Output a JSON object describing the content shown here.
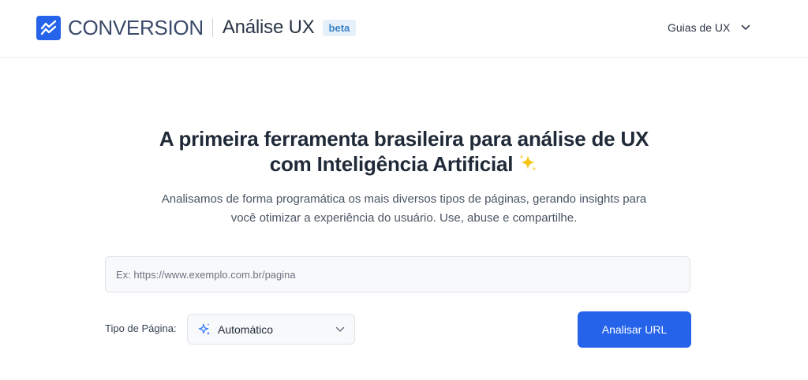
{
  "header": {
    "brand_name": "CONVERSION",
    "product_name": "Análise UX",
    "badge": "beta",
    "nav_guides": "Guias de UX"
  },
  "hero": {
    "title_line1": "A primeira ferramenta brasileira para análise de UX",
    "title_line2": "com Inteligência Artificial",
    "subtitle_line1": "Analisamos de forma programática os mais diversos tipos de páginas, gerando insights para",
    "subtitle_line2": "você otimizar a experiência do usuário. Use, abuse e compartilhe."
  },
  "form": {
    "url_placeholder": "Ex: https://www.exemplo.com.br/pagina",
    "url_value": "",
    "page_type_label": "Tipo de Página:",
    "page_type_value": "Automático",
    "submit_label": "Analisar URL"
  },
  "icons": {
    "logo": "chart-line-icon",
    "guides_chevron": "chevron-down-icon",
    "title_sparkle": "sparkles-icon",
    "select_sparkle": "sparkles-icon",
    "select_chevron": "chevron-down-icon"
  },
  "colors": {
    "accent": "#2563eb",
    "brand_text": "#3b4a6b",
    "badge_bg": "#e6f0fb",
    "badge_text": "#3b82c4",
    "sparkle": "#f5c518"
  }
}
